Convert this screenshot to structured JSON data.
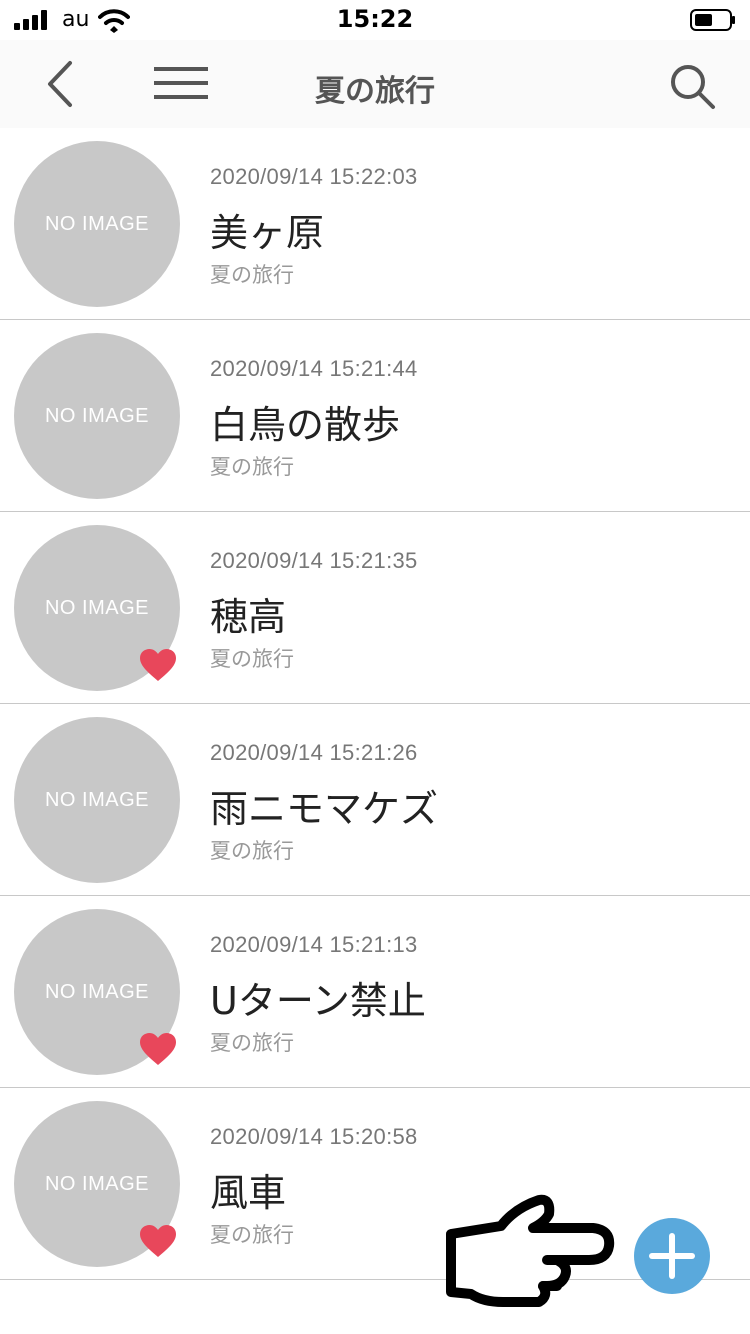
{
  "status_bar": {
    "carrier": "au",
    "time": "15:22"
  },
  "nav": {
    "title": "夏の旅行",
    "back_icon": "chevron-left-icon",
    "menu_icon": "hamburger-menu-icon",
    "search_icon": "search-icon"
  },
  "no_image_label": "NO IMAGE",
  "notes": [
    {
      "date": "2020/09/14 15:22:03",
      "title": "美ヶ原",
      "folder": "夏の旅行",
      "favorite": false
    },
    {
      "date": "2020/09/14 15:21:44",
      "title": "白鳥の散歩",
      "folder": "夏の旅行",
      "favorite": false
    },
    {
      "date": "2020/09/14 15:21:35",
      "title": "穂高",
      "folder": "夏の旅行",
      "favorite": true
    },
    {
      "date": "2020/09/14 15:21:26",
      "title": "雨ニモマケズ",
      "folder": "夏の旅行",
      "favorite": false
    },
    {
      "date": "2020/09/14 15:21:13",
      "title": "Uターン禁止",
      "folder": "夏の旅行",
      "favorite": true
    },
    {
      "date": "2020/09/14 15:20:58",
      "title": "風車",
      "folder": "夏の旅行",
      "favorite": true
    }
  ],
  "colors": {
    "thumbnail": "#c8c8c8",
    "heart": "#e8475b",
    "add_button": "#5aa9dc"
  }
}
